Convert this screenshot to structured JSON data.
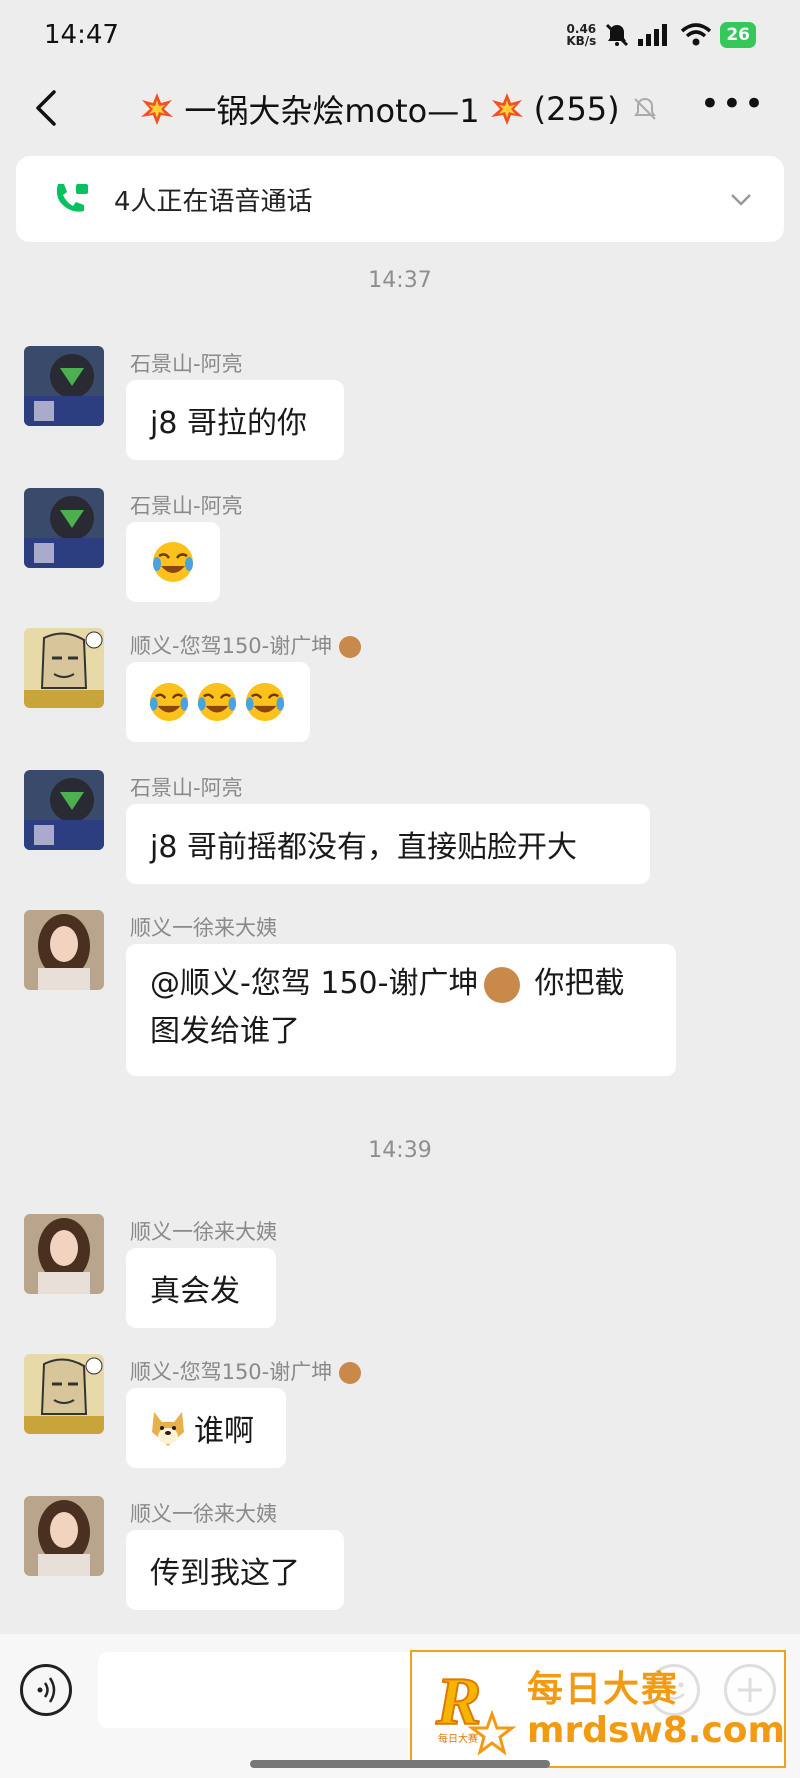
{
  "status_bar": {
    "time": "14:47",
    "speed_value": "0.46",
    "speed_unit": "KB/s",
    "battery": "26"
  },
  "header": {
    "title": "一锅大杂烩moto—1",
    "count": "(255)"
  },
  "banner": {
    "text": "4人正在语音通话"
  },
  "timestamps": [
    "14:37",
    "14:39"
  ],
  "messages": [
    {
      "sender": "石景山-阿亮",
      "text": "j8 哥拉的你"
    },
    {
      "sender": "石景山-阿亮",
      "text": ""
    },
    {
      "sender": "顺义-您驾150-谢广坤",
      "text": ""
    },
    {
      "sender": "石景山-阿亮",
      "text": "j8 哥前摇都没有，直接贴脸开大"
    },
    {
      "sender": "顺义一徐来大姨",
      "line1": "@顺义-您驾 150-谢广坤",
      "line1b": "你把截",
      "line2": "图发给谁了"
    },
    {
      "sender": "顺义一徐来大姨",
      "text": "真会发"
    },
    {
      "sender": "顺义-您驾150-谢广坤",
      "text": "谁啊"
    },
    {
      "sender": "顺义一徐来大姨",
      "text": "传到我这了"
    }
  ],
  "watermark": {
    "line1": "每日大赛",
    "line2": "mrdsw8.com",
    "logo_text": "每日大赛"
  },
  "colors": {
    "accent_green": "#07c160",
    "watermark_orange": "#f29b12",
    "battery_green": "#34c759"
  }
}
